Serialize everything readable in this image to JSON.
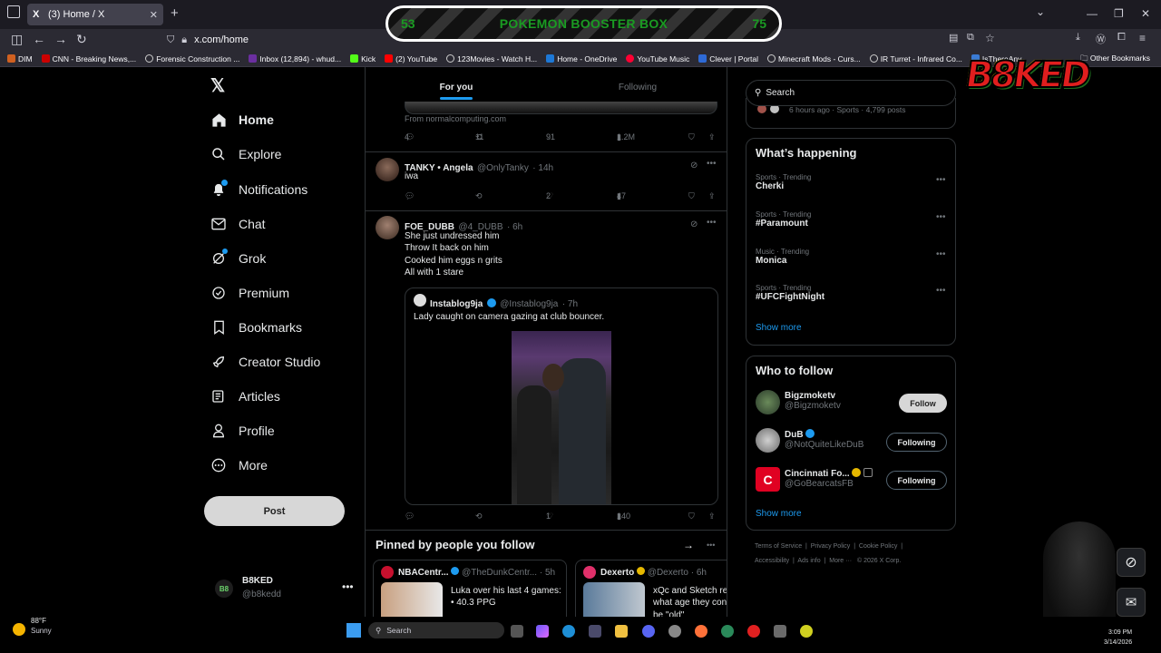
{
  "browser": {
    "tab_title": "(3) Home / X",
    "tab_favicon": "X",
    "url": "x.com/home",
    "bookmarks": [
      {
        "label": "DIM",
        "color": "#d06020"
      },
      {
        "label": "CNN - Breaking News,...",
        "color": "#cc0000"
      },
      {
        "label": "Forensic Construction ...",
        "color": "#888888"
      },
      {
        "label": "Inbox (12,894) - whud...",
        "color": "#6b2fa0"
      },
      {
        "label": "Kick",
        "color": "#53fc18"
      },
      {
        "label": "(2) YouTube",
        "color": "#ff0000"
      },
      {
        "label": "123Movies - Watch H...",
        "color": "#888888"
      },
      {
        "label": "Home - OneDrive",
        "color": "#1d78d6"
      },
      {
        "label": "YouTube Music",
        "color": "#ff0033"
      },
      {
        "label": "Clever | Portal",
        "color": "#2e6ad6"
      },
      {
        "label": "Minecraft Mods - Curs...",
        "color": "#888888"
      },
      {
        "label": "IR Turret - Infrared Co...",
        "color": "#888888"
      },
      {
        "label": "IsThereAny",
        "color": "#3a7bd5"
      }
    ],
    "other_bookmarks": "Other Bookmarks"
  },
  "overlay": {
    "left_value": "53",
    "title": "POKEMON BOOSTER BOX",
    "right_value": "75",
    "logo": "B8KED"
  },
  "sidebar": {
    "items": [
      {
        "label": "Home",
        "icon": "home-icon"
      },
      {
        "label": "Explore",
        "icon": "search-icon"
      },
      {
        "label": "Notifications",
        "icon": "bell-icon"
      },
      {
        "label": "Chat",
        "icon": "envelope-icon"
      },
      {
        "label": "Grok",
        "icon": "grok-icon"
      },
      {
        "label": "Premium",
        "icon": "premium-icon"
      },
      {
        "label": "Bookmarks",
        "icon": "bookmark-icon"
      },
      {
        "label": "Creator Studio",
        "icon": "rocket-icon"
      },
      {
        "label": "Articles",
        "icon": "articles-icon"
      },
      {
        "label": "Profile",
        "icon": "person-icon"
      },
      {
        "label": "More",
        "icon": "more-circle-icon"
      }
    ],
    "post_label": "Post",
    "account": {
      "name": "B8KED",
      "handle": "@b8kedd",
      "avatar_text": "B8"
    }
  },
  "feed": {
    "tabs": [
      "For you",
      "Following"
    ],
    "tweet0": {
      "source": "From normalcomputing.com",
      "replies": "4",
      "reposts": "11",
      "likes": "91",
      "views": "1.2M"
    },
    "tweet1": {
      "name": "TANKY • Angela",
      "handle": "@OnlyTanky",
      "time": "· 14h",
      "text": "iwa",
      "replies": "",
      "reposts": "",
      "likes": "2",
      "views": "47"
    },
    "tweet2": {
      "name": "FOE_DUBB",
      "handle": "@4_DUBB",
      "time": "· 6h",
      "lines": [
        "She just undressed him",
        "Throw It back on him",
        "Cooked him eggs n grits",
        "All with 1 stare"
      ],
      "quote": {
        "name": "Instablog9ja",
        "handle": "@Instablog9ja",
        "time": "· 7h",
        "text": "Lady caught on camera gazing at club bouncer."
      },
      "replies": "",
      "reposts": "",
      "likes": "1",
      "views": "140"
    },
    "pinned": {
      "title": "Pinned by people you follow",
      "cards": [
        {
          "name": "NBACentr...",
          "handle": "@TheDunkCentr...",
          "time": "· 5h",
          "text": "Luka over his last 4 games:",
          "text2": "• 40.3 PPG"
        },
        {
          "name": "Dexerto",
          "handle": "@Dexerto",
          "time": "· 6h",
          "text": "xQc and Sketch re",
          "text2": "what age they con",
          "text3": "be \"old\""
        }
      ]
    }
  },
  "right": {
    "search_placeholder": "Search",
    "top_snippet": "6 hours ago · Sports · 4,799 posts",
    "happening": {
      "title": "What’s happening",
      "trends": [
        {
          "category": "Sports · Trending",
          "name": "Cherki"
        },
        {
          "category": "Sports · Trending",
          "name": "#Paramount"
        },
        {
          "category": "Music · Trending",
          "name": "Monica"
        },
        {
          "category": "Sports · Trending",
          "name": "#UFCFightNight"
        }
      ],
      "show_more": "Show more"
    },
    "who_to_follow": {
      "title": "Who to follow",
      "users": [
        {
          "name": "Bigzmoketv",
          "handle": "@Bigzmoketv",
          "button": "Follow"
        },
        {
          "name": "DuB",
          "handle": "@NotQuiteLikeDuB",
          "button": "Following"
        },
        {
          "name": "Cincinnati Fo...",
          "handle": "@GoBearcatsFB",
          "button": "Following"
        }
      ],
      "show_more": "Show more"
    },
    "footer": {
      "line1": [
        "Terms of Service",
        "Privacy Policy",
        "Cookie Policy"
      ],
      "line2": [
        "Accessibility",
        "Ads info",
        "More ···",
        "© 2026 X Corp."
      ]
    }
  },
  "taskbar": {
    "weather_temp": "88°F",
    "weather_desc": "Sunny",
    "search_label": "Search",
    "time": "3:09 PM",
    "date": "3/14/2026"
  }
}
